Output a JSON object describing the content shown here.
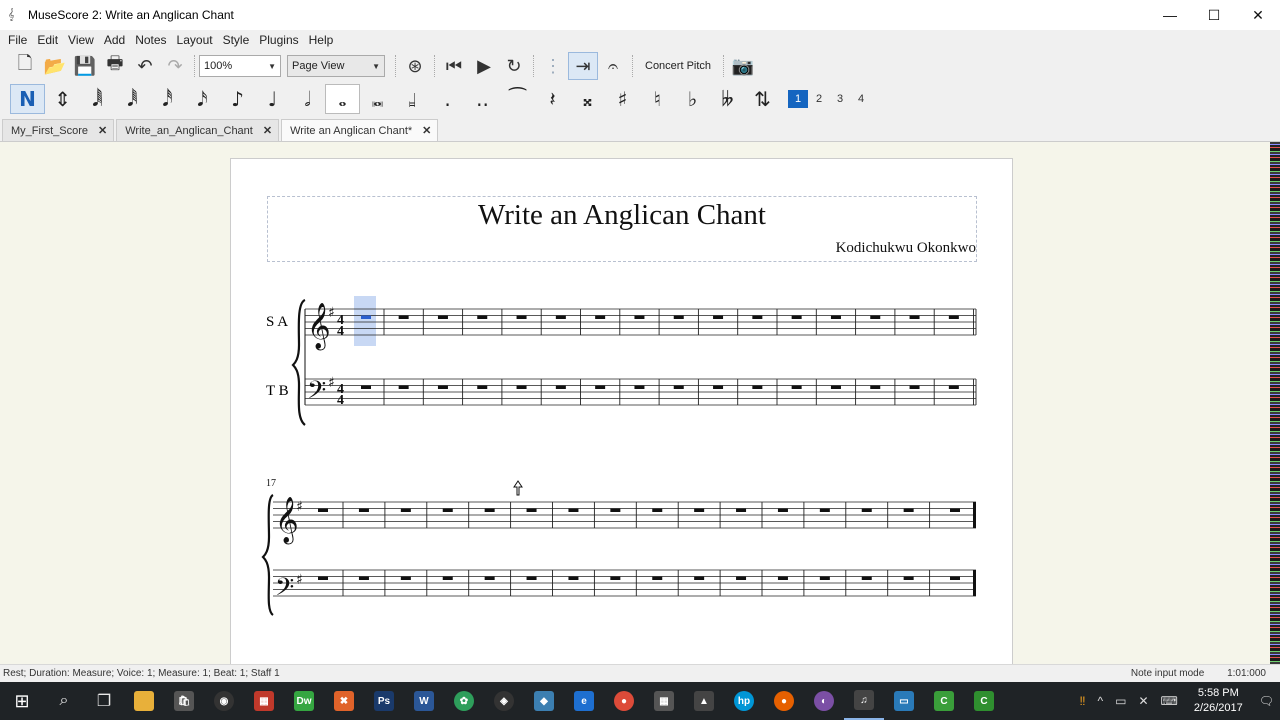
{
  "window": {
    "title": "MuseScore 2: Write an Anglican Chant"
  },
  "menu": [
    "File",
    "Edit",
    "View",
    "Add",
    "Notes",
    "Layout",
    "Style",
    "Plugins",
    "Help"
  ],
  "toolbar": {
    "zoom_value": "100%",
    "view_mode": "Page View",
    "concert_pitch_label": "Concert Pitch"
  },
  "note_input": {
    "voices": [
      "1",
      "2",
      "3",
      "4"
    ],
    "active_voice": "1"
  },
  "tabs": [
    {
      "label": "My_First_Score",
      "active": false
    },
    {
      "label": "Write_an_Anglican_Chant",
      "active": false
    },
    {
      "label": "Write an Anglican Chant*",
      "active": true
    }
  ],
  "score": {
    "title": "Write an Anglican Chant",
    "composer": "Kodichukwu Okonkwo",
    "staff_upper_label": "S A",
    "staff_lower_label": "T B",
    "system2_measure_number": "17"
  },
  "status": {
    "left": "Rest; Duration: Measure; Voice: 1;  Measure: 1; Beat: 1; Staff 1",
    "mode": "Note input mode",
    "position": "1:01:000"
  },
  "taskbar": {
    "time": "5:58 PM",
    "date": "2/26/2017"
  },
  "colors": {
    "selection": "#c8d8f4",
    "accent": "#1565c0",
    "taskbar": "#1f2326"
  }
}
